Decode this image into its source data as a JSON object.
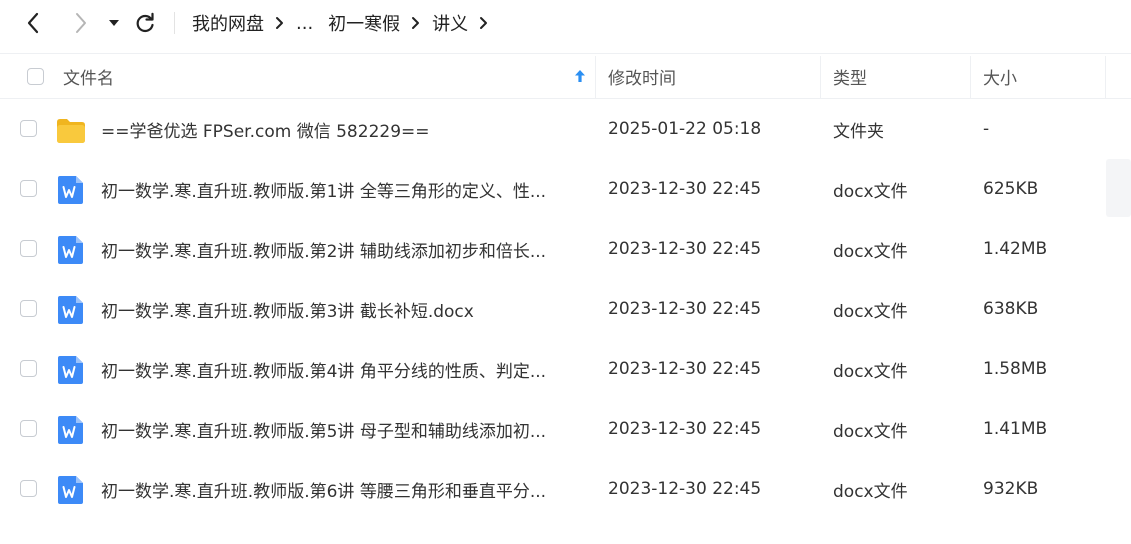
{
  "breadcrumb": {
    "items": [
      "我的网盘",
      "...",
      "初一寒假",
      "讲义"
    ]
  },
  "columns": {
    "name": "文件名",
    "modified": "修改时间",
    "type": "类型",
    "size": "大小"
  },
  "colors": {
    "sort_arrow": "#2b8ff2",
    "folder": "#f7c23a",
    "docx_icon": "#3d8af7"
  },
  "files": [
    {
      "name": "==学爸优选 FPSer.com 微信 582229==",
      "modified": "2025-01-22 05:18",
      "type": "文件夹",
      "size": "-",
      "icon": "folder-icon"
    },
    {
      "name": "初一数学.寒.直升班.教师版.第1讲  全等三角形的定义、性...",
      "modified": "2023-12-30 22:45",
      "type": "docx文件",
      "size": "625KB",
      "icon": "word-doc-icon"
    },
    {
      "name": "初一数学.寒.直升班.教师版.第2讲  辅助线添加初步和倍长...",
      "modified": "2023-12-30 22:45",
      "type": "docx文件",
      "size": "1.42MB",
      "icon": "word-doc-icon"
    },
    {
      "name": "初一数学.寒.直升班.教师版.第3讲  截长补短.docx",
      "modified": "2023-12-30 22:45",
      "type": "docx文件",
      "size": "638KB",
      "icon": "word-doc-icon"
    },
    {
      "name": "初一数学.寒.直升班.教师版.第4讲  角平分线的性质、判定...",
      "modified": "2023-12-30 22:45",
      "type": "docx文件",
      "size": "1.58MB",
      "icon": "word-doc-icon"
    },
    {
      "name": "初一数学.寒.直升班.教师版.第5讲  母子型和辅助线添加初...",
      "modified": "2023-12-30 22:45",
      "type": "docx文件",
      "size": "1.41MB",
      "icon": "word-doc-icon"
    },
    {
      "name": "初一数学.寒.直升班.教师版.第6讲  等腰三角形和垂直平分...",
      "modified": "2023-12-30 22:45",
      "type": "docx文件",
      "size": "932KB",
      "icon": "word-doc-icon"
    }
  ]
}
